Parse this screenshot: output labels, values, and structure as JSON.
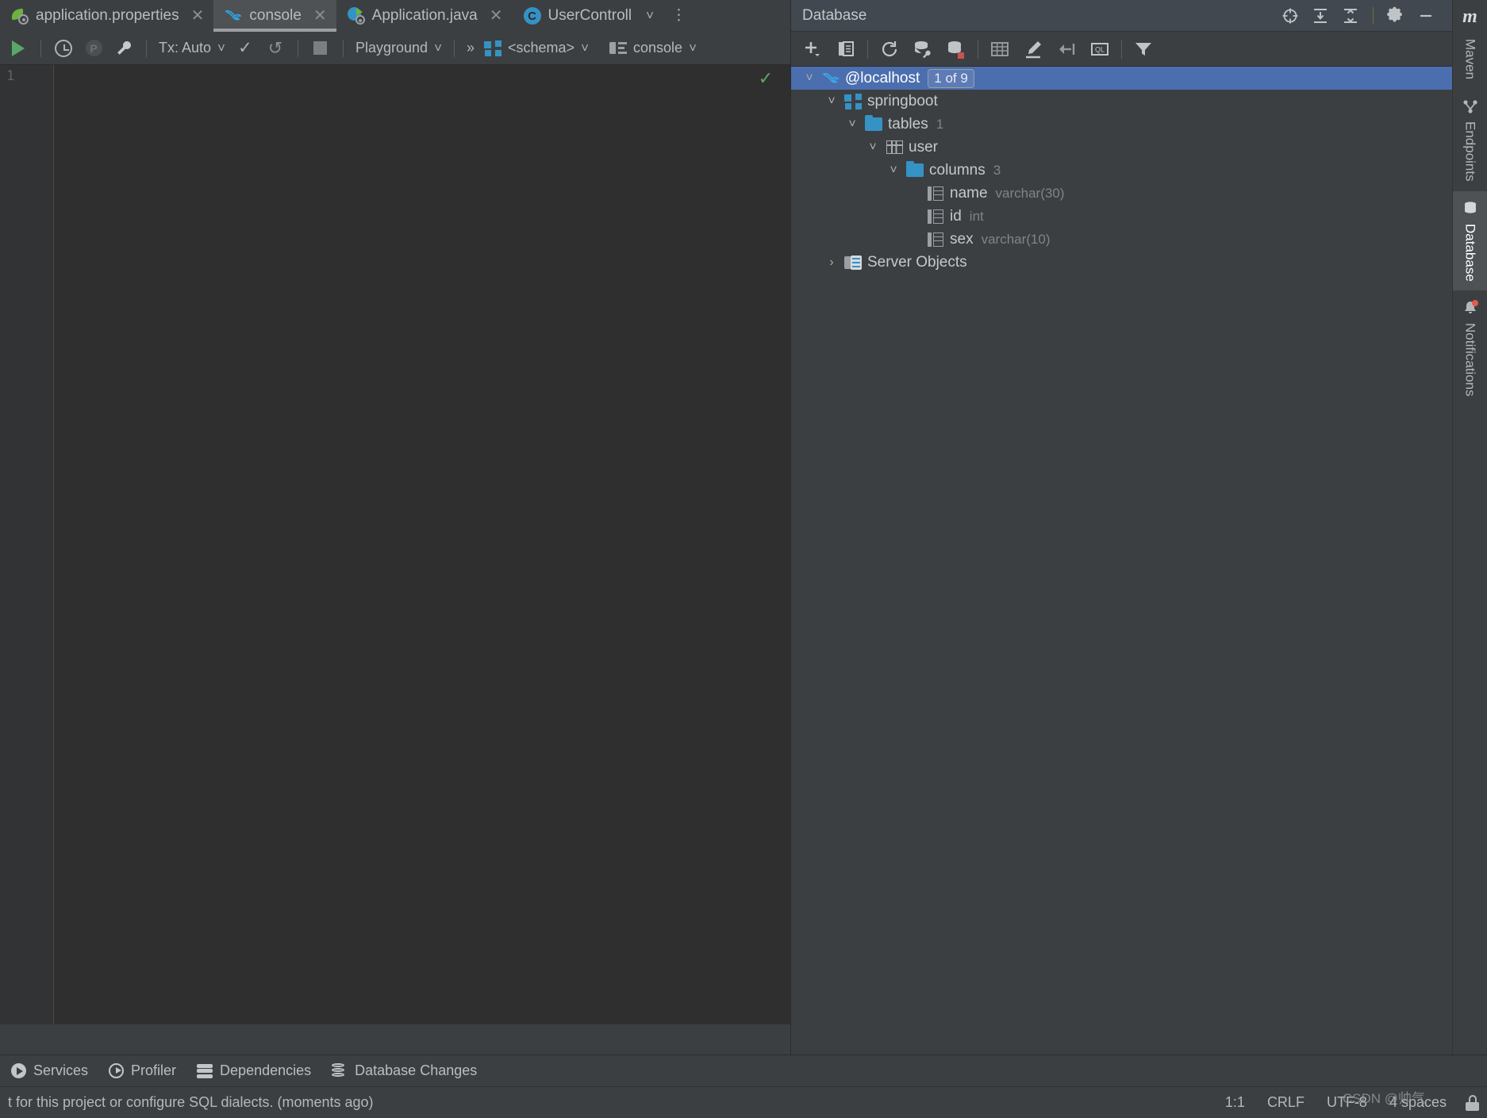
{
  "editor_tabs": [
    {
      "label": "application.properties",
      "icon": "spring-leaf-icon",
      "active": false,
      "closable": true
    },
    {
      "label": "console",
      "icon": "mysql-dolphin-icon",
      "active": true,
      "closable": true
    },
    {
      "label": "Application.java",
      "icon": "spring-boot-app-icon",
      "active": false,
      "closable": true
    },
    {
      "label": "UserControll",
      "icon": "java-class-icon",
      "active": false,
      "closable": false
    }
  ],
  "tab_overflow": {
    "chevron": "chevron-down-icon",
    "more": "more-vertical-icon"
  },
  "console_toolbar": {
    "run_label": "Execute",
    "history_label": "History",
    "profile_label": "Profile",
    "settings_label": "Data Source Properties",
    "tx_label": "Tx: Auto",
    "commit_label": "Commit",
    "rollback_label": "Rollback",
    "stop_label": "Stop",
    "datasource_label": "Playground",
    "overflow_label": "»",
    "schema_label": "<schema>",
    "session_label": "console"
  },
  "editor": {
    "line_number": "1",
    "content": "",
    "inspection_status": "ok"
  },
  "database_panel": {
    "title": "Database",
    "header_icons": [
      "locate-icon",
      "expand-all-icon",
      "collapse-all-icon",
      "gear-icon",
      "minimize-icon"
    ],
    "toolbar_icons": [
      "add-new-icon",
      "duplicate-icon",
      "refresh-icon",
      "database-tools-icon",
      "database-modify-icon",
      "table-editor-icon",
      "edit-icon",
      "jump-to-icon",
      "query-language-icon",
      "filter-icon"
    ],
    "tree": [
      {
        "indent": 0,
        "twisty": "expanded",
        "icon": "mysql-dolphin-icon",
        "label": "@localhost",
        "badge": "1 of 9",
        "selected": true
      },
      {
        "indent": 1,
        "twisty": "expanded",
        "icon": "schema-icon",
        "label": "springboot",
        "meta": ""
      },
      {
        "indent": 2,
        "twisty": "expanded",
        "icon": "folder-icon",
        "label": "tables",
        "meta": "1"
      },
      {
        "indent": 3,
        "twisty": "expanded",
        "icon": "table-icon",
        "label": "user",
        "meta": ""
      },
      {
        "indent": 4,
        "twisty": "expanded",
        "icon": "folder-icon",
        "label": "columns",
        "meta": "3"
      },
      {
        "indent": 5,
        "twisty": "none",
        "icon": "column-icon",
        "label": "name",
        "meta": "varchar(30)"
      },
      {
        "indent": 5,
        "twisty": "none",
        "icon": "column-icon",
        "label": "id",
        "meta": "int"
      },
      {
        "indent": 5,
        "twisty": "none",
        "icon": "column-icon",
        "label": "sex",
        "meta": "varchar(10)"
      },
      {
        "indent": 1,
        "twisty": "collapsed",
        "icon": "server-objects-icon",
        "label": "Server Objects",
        "meta": ""
      }
    ]
  },
  "right_sidebar": {
    "logo": "m",
    "tabs": [
      {
        "label": "Maven",
        "icon": "",
        "active": false
      },
      {
        "label": "Endpoints",
        "icon": "endpoints-icon",
        "active": false
      },
      {
        "label": "Database",
        "icon": "database-icon",
        "active": true
      },
      {
        "label": "Notifications",
        "icon": "bell-icon",
        "active": false,
        "has_dot": true
      }
    ]
  },
  "tool_window_bar": [
    {
      "label": "Services",
      "icon": "services-icon"
    },
    {
      "label": "Profiler",
      "icon": "profiler-icon"
    },
    {
      "label": "Dependencies",
      "icon": "dependencies-icon"
    },
    {
      "label": "Database Changes",
      "icon": "database-changes-icon"
    }
  ],
  "status_bar": {
    "message": "t for this project or configure SQL dialects. (moments ago)",
    "caret": "1:1",
    "line_separator": "CRLF",
    "encoding": "UTF-8",
    "indent": "4 spaces",
    "lock": "read-only-lock-icon",
    "watermark": "CSDN @帅气"
  }
}
